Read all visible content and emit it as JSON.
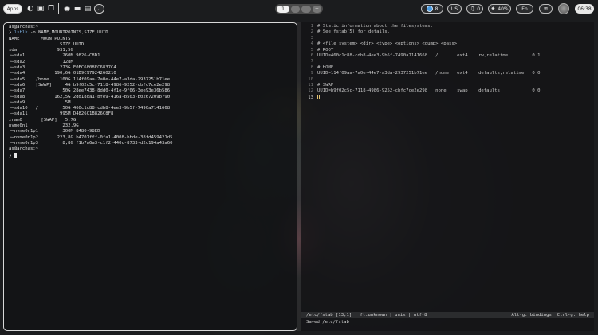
{
  "topbar": {
    "apps_label": "Apps",
    "icons": [
      "palette-icon",
      "image-icon",
      "copy-icon",
      "globe-icon",
      "folder-icon",
      "briefcase-icon"
    ],
    "menu_label": "⌄",
    "workspaces": [
      "1",
      "",
      "",
      ""
    ],
    "workspace_add": "+",
    "status": {
      "battery_value": "8",
      "keyboard_layout": "US",
      "notifications": "0",
      "brightness": "40%",
      "language": "En"
    },
    "clock": "06:38"
  },
  "terminal": {
    "lines": [
      {
        "type": "prompt",
        "text": "as@archas:~"
      },
      {
        "type": "command",
        "arrow": "❯",
        "cmd": "lsblk",
        "args": " -o NAME,MOUNTPOINTS,SIZE,UUID"
      },
      {
        "type": "out",
        "text": "NAME        MOUNTPOINTS"
      },
      {
        "type": "out",
        "text": "                   SIZE UUID"
      },
      {
        "type": "out",
        "text": "sda               931,5G"
      },
      {
        "type": "out",
        "text": "├─sda1              260M 9826-C8D1"
      },
      {
        "type": "out",
        "text": "├─sda2              128M"
      },
      {
        "type": "out",
        "text": "├─sda3             273G E0FC6808FC6837C4"
      },
      {
        "type": "out",
        "text": "├─sda4           190,6G 01D9C97924260210"
      },
      {
        "type": "out",
        "text": "├─sda5    /home    100G 114f09aa-7a0e-44e7-a3da-2937251b71ee"
      },
      {
        "type": "out",
        "text": "├─sda6    [SWAP]     4G b9f02c5c-7118-4986-9252-cbfc7ce2e298"
      },
      {
        "type": "out",
        "text": "├─sda7              50G 28ee7438-8dd0-4f1e-9f06-3ee93e36b586"
      },
      {
        "type": "out",
        "text": "├─sda8           162,5G 2dd18da1-bfe9-416a-b503-b0267209b790"
      },
      {
        "type": "out",
        "text": "├─sda9               5M"
      },
      {
        "type": "out",
        "text": "├─sda10   /         50G 460c1c88-cdb8-4ee3-9b5f-7490a7141668"
      },
      {
        "type": "out",
        "text": "└─sda11            995M D4826C1B826C8F8"
      },
      {
        "type": "out",
        "text": "zram0       [SWAP]   5,7G"
      },
      {
        "type": "out",
        "text": "nvme0n1             232,9G"
      },
      {
        "type": "out",
        "text": "├─nvme0n1p1         300M 8480-98ED"
      },
      {
        "type": "out",
        "text": "├─nvme0n1p2       223,8G b4707fff-0fa1-4008-bbde-38fd459421d5"
      },
      {
        "type": "out",
        "text": "└─nvme0n1p3         8,8G f1b7a6a3-c1f2-440c-8733-d2c194a43a60"
      },
      {
        "type": "prompt",
        "text": "as@archas:~"
      }
    ],
    "final_arrow": "❯"
  },
  "editor": {
    "lines": [
      {
        "n": "1",
        "text": "# Static information about the filesystems."
      },
      {
        "n": "2",
        "text": "# See fstab(5) for details."
      },
      {
        "n": "3",
        "text": ""
      },
      {
        "n": "4",
        "text": "# <file system> <dir> <type> <options> <dump> <pass>"
      },
      {
        "n": "5",
        "text": "# ROOT"
      },
      {
        "n": "6",
        "text": "UUID=460c1c88-cdb8-4ee3-9b5f-7490a7141668   /       ext4    rw,relatime         0 1"
      },
      {
        "n": "7",
        "text": ""
      },
      {
        "n": "8",
        "text": "# HOME"
      },
      {
        "n": "9",
        "text": "UUID=114f09aa-7a0e-44e7-a3da-2937251b71ee   /home   ext4    defaults,relatime   0 0"
      },
      {
        "n": "10",
        "text": ""
      },
      {
        "n": "11",
        "text": "# SWAP"
      },
      {
        "n": "12",
        "text": "UUID=b9f02c5c-7118-4986-9252-cbfc7ce2e298   none    swap    defaults            0 0"
      },
      {
        "n": "13",
        "text": ""
      }
    ],
    "status_left": "/etc/fstab [13,1] | ft:unknown | unix | utf-8",
    "status_right": "Alt-g: bindings, Ctrl-g: help",
    "message": "Saved /etc/fstab"
  }
}
